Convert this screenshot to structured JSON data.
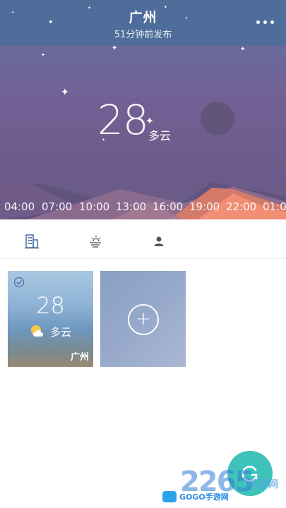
{
  "header": {
    "city": "广州",
    "published": "51分钟前发布",
    "more_icon": "more-dots-icon"
  },
  "current": {
    "temperature": "28",
    "condition": "多云",
    "icon": "crescent-moon-icon"
  },
  "timeline": [
    "04:00",
    "07:00",
    "10:00",
    "13:00",
    "16:00",
    "19:00",
    "22:00",
    "01:0"
  ],
  "tabs": [
    {
      "icon": "city-building-icon",
      "active": true
    },
    {
      "icon": "sun-haze-icon",
      "active": false
    },
    {
      "icon": "user-icon",
      "active": false
    }
  ],
  "cards": {
    "city": {
      "temperature": "28",
      "condition": "多云",
      "name": "广州",
      "icon": "partly-cloudy-icon",
      "selected_icon": "check-circle-icon"
    },
    "add": {
      "label": "+",
      "icon": "add-circle-icon"
    }
  },
  "fab": {
    "icon": "refresh-icon",
    "color": "#3fc2ba"
  },
  "watermark": {
    "number": "2265",
    "suffix": "手游网",
    "brand": "GOGO手游网"
  },
  "colors": {
    "header": "#4f6d9a",
    "accent": "#3fc2ba",
    "tab_active": "#4a6ea5"
  }
}
